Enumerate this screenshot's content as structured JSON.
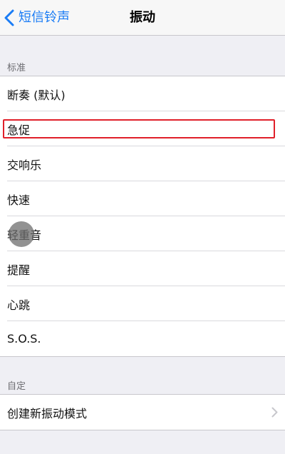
{
  "navbar": {
    "back_label": "短信铃声",
    "title": "振动"
  },
  "standard_section": {
    "header": "标准",
    "items": [
      {
        "label": "断奏 (默认)"
      },
      {
        "label": "急促",
        "highlighted": true
      },
      {
        "label": "交响乐"
      },
      {
        "label": "快速"
      },
      {
        "label": "轻重音"
      },
      {
        "label": "提醒"
      },
      {
        "label": "心跳"
      },
      {
        "label": "S.O.S."
      }
    ]
  },
  "custom_section": {
    "header": "自定",
    "create_label": "创建新振动模式"
  },
  "colors": {
    "accent": "#1a7cf5",
    "highlight_border": "#e0202a",
    "background": "#efeff4"
  },
  "icons": {
    "back": "chevron-left-icon",
    "disclosure": "chevron-right-icon"
  }
}
